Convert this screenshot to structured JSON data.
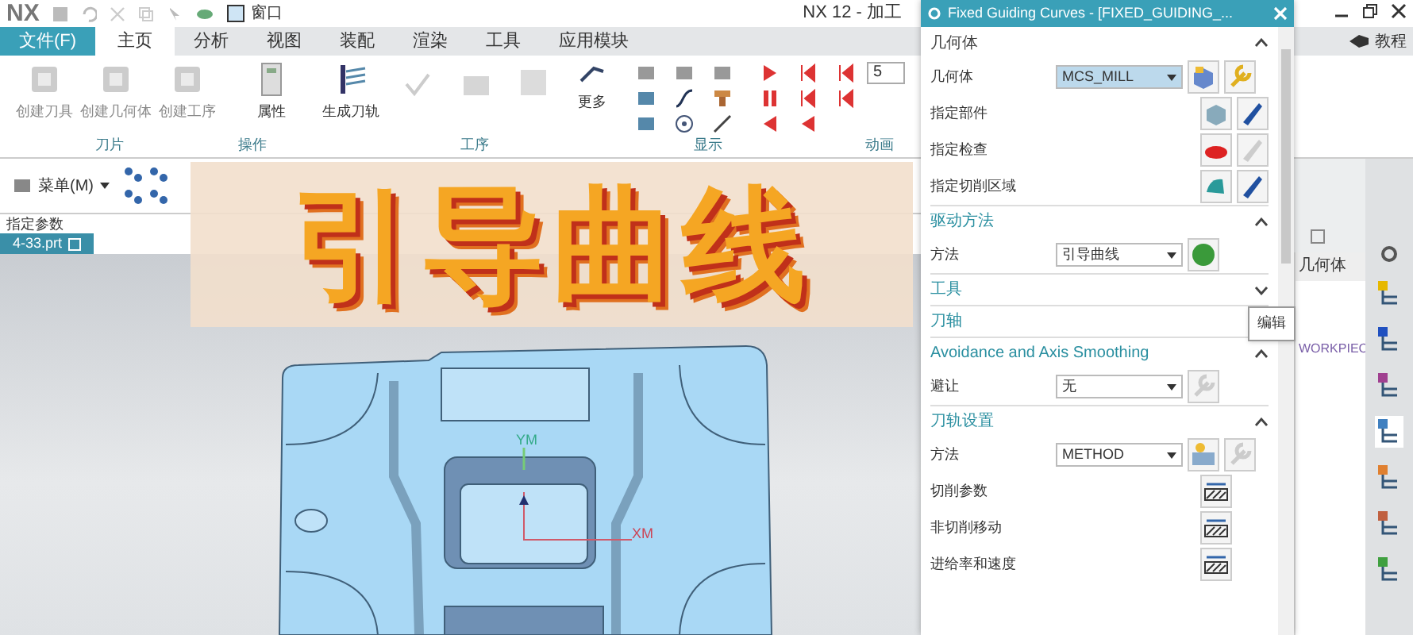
{
  "title_bar": {
    "logo": "NX",
    "window_menu": "窗口",
    "app_title": "NX 12 - 加工",
    "tutorial": "教程"
  },
  "tabs": [
    {
      "label": "文件(F)",
      "kind": "file",
      "selected": false
    },
    {
      "label": "主页",
      "kind": "tab",
      "selected": true
    },
    {
      "label": "分析",
      "kind": "tab",
      "selected": false
    },
    {
      "label": "视图",
      "kind": "tab",
      "selected": false
    },
    {
      "label": "装配",
      "kind": "tab",
      "selected": false
    },
    {
      "label": "渲染",
      "kind": "tab",
      "selected": false
    },
    {
      "label": "工具",
      "kind": "tab",
      "selected": false
    },
    {
      "label": "应用模块",
      "kind": "tab",
      "selected": false
    }
  ],
  "ribbon": {
    "buttons": [
      {
        "label": "创建刀具",
        "disabled": true
      },
      {
        "label": "创建几何体",
        "disabled": true
      },
      {
        "label": "创建工序",
        "disabled": true
      },
      {
        "label": "属性",
        "disabled": false
      },
      {
        "label": "生成刀轨",
        "disabled": false
      },
      {
        "label": "更多",
        "disabled": false
      }
    ],
    "speed_value": "5",
    "groups": [
      "刀片",
      "操作",
      "工序",
      "显示",
      "动画"
    ]
  },
  "menu_button": "菜单(M)",
  "left_label": "指定参数",
  "file_tab": "4-33.prt",
  "banner": "引导曲线",
  "viewport": {
    "axes": [
      "YM",
      "XM"
    ]
  },
  "dialog": {
    "title": "Fixed Guiding Curves - [FIXED_GUIDING_...",
    "sections": [
      {
        "title": "几何体",
        "expanded": true,
        "rows": [
          {
            "kind": "dropdown",
            "label": "几何体",
            "value": "MCS_MILL",
            "highlighted": true
          },
          {
            "kind": "icons",
            "label": "指定部件"
          },
          {
            "kind": "icons",
            "label": "指定检查"
          },
          {
            "kind": "icons",
            "label": "指定切削区域"
          }
        ]
      },
      {
        "title": "驱动方法",
        "expanded": true,
        "rows": [
          {
            "kind": "dropdown",
            "label": "方法",
            "value": "引导曲线",
            "highlighted": false
          }
        ]
      },
      {
        "title": "工具",
        "expanded": false
      },
      {
        "title": "刀轴",
        "expanded": false
      },
      {
        "title": "Avoidance and Axis Smoothing",
        "expanded": true,
        "rows": [
          {
            "kind": "dropdown",
            "label": "避让",
            "value": "无",
            "highlighted": false
          }
        ]
      },
      {
        "title": "刀轨设置",
        "expanded": true,
        "rows": [
          {
            "kind": "dropdown",
            "label": "方法",
            "value": "METHOD",
            "highlighted": false
          },
          {
            "kind": "icons",
            "label": "切削参数"
          },
          {
            "kind": "icons",
            "label": "非切削移动"
          },
          {
            "kind": "icons",
            "label": "进给率和速度"
          }
        ]
      }
    ],
    "tooltip": "编辑"
  },
  "navigator": {
    "column": "几何体",
    "item": "WORKPIEC"
  }
}
